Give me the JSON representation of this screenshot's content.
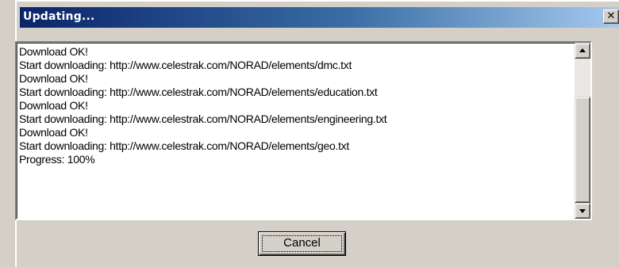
{
  "window": {
    "title": "Updating...",
    "close_glyph": "✕",
    "close_icon": "close-icon"
  },
  "log": {
    "lines": [
      "Download OK!",
      "Start downloading: http://www.celestrak.com/NORAD/elements/dmc.txt",
      "Download OK!",
      "Start downloading: http://www.celestrak.com/NORAD/elements/education.txt",
      "Download OK!",
      "Start downloading: http://www.celestrak.com/NORAD/elements/engineering.txt",
      "Download OK!",
      "Start downloading: http://www.celestrak.com/NORAD/elements/geo.txt",
      "Progress: 100%"
    ]
  },
  "buttons": {
    "cancel_label": "Cancel"
  },
  "colors": {
    "title_gradient_start": "#0a246a",
    "title_gradient_end": "#a6caf0",
    "face": "#d4d0c8"
  }
}
